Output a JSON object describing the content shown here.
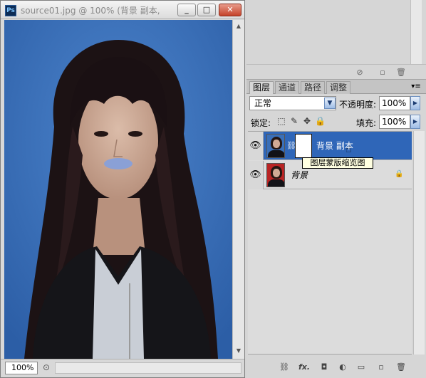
{
  "document": {
    "title": "source01.jpg @ 100% (背景 副本, ...",
    "app_icon": "Ps",
    "zoom": "100%",
    "window_buttons": {
      "minimize": "_",
      "maximize": "□",
      "close": "✕"
    }
  },
  "colors": {
    "canvas_background": "#3a6fb8",
    "selected_layer": "#2f66b8",
    "tooltip_background": "#ffffe1"
  },
  "layers_panel": {
    "tabs": [
      {
        "label": "图层",
        "active": true
      },
      {
        "label": "通道",
        "active": false
      },
      {
        "label": "路径",
        "active": false
      },
      {
        "label": "调整",
        "active": false
      }
    ],
    "blend_mode": "正常",
    "opacity_label": "不透明度:",
    "opacity_value": "100%",
    "lock_label": "锁定:",
    "fill_label": "填充:",
    "fill_value": "100%",
    "layers": [
      {
        "name": "背景 副本",
        "selected": true,
        "has_mask": true
      },
      {
        "name": "背景",
        "selected": false,
        "locked": true
      }
    ],
    "tooltip": "图层蒙版缩览图",
    "footer_icons": [
      "link-layers-icon",
      "fx-icon",
      "add-mask-icon",
      "adjustment-layer-icon",
      "new-group-icon",
      "new-layer-icon",
      "delete-icon"
    ],
    "fx_label": "fx."
  }
}
